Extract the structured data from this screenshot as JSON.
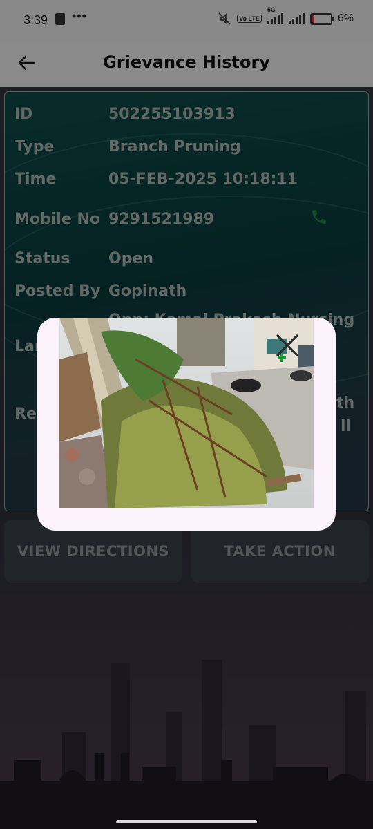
{
  "status_bar": {
    "time": "3:39",
    "overflow": "•••",
    "network_badge": "Vo LTE",
    "network_type": "5G",
    "battery": "6%"
  },
  "app_bar": {
    "title": "Grievance History"
  },
  "grievance": {
    "id_label": "ID",
    "id_value": "502255103913",
    "type_label": "Type",
    "type_value": "Branch Pruning",
    "time_label": "Time",
    "time_value": "05-FEB-2025 10:18:11",
    "mobile_label": "Mobile No",
    "mobile_value": "9291521989",
    "status_label": "Status",
    "status_value": "Open",
    "posted_by_label": "Posted By",
    "posted_by_value": "Gopinath",
    "landmark_label": "Lan",
    "landmark_value": "Opp: Kamal Prakash Nursing",
    "remarks_label": "Rem",
    "remarks_value_1": "th",
    "remarks_value_2": "ll"
  },
  "buttons": {
    "view_directions": "VIEW DIRECTIONS",
    "take_action": "TAKE ACTION"
  },
  "dialog": {
    "close_icon": "close-icon",
    "image": "grievance-photo"
  },
  "colors": {
    "card_teal": "#0e4c48",
    "phone_green": "#1c8a3a",
    "dialog_bg": "#fbf2fb"
  }
}
